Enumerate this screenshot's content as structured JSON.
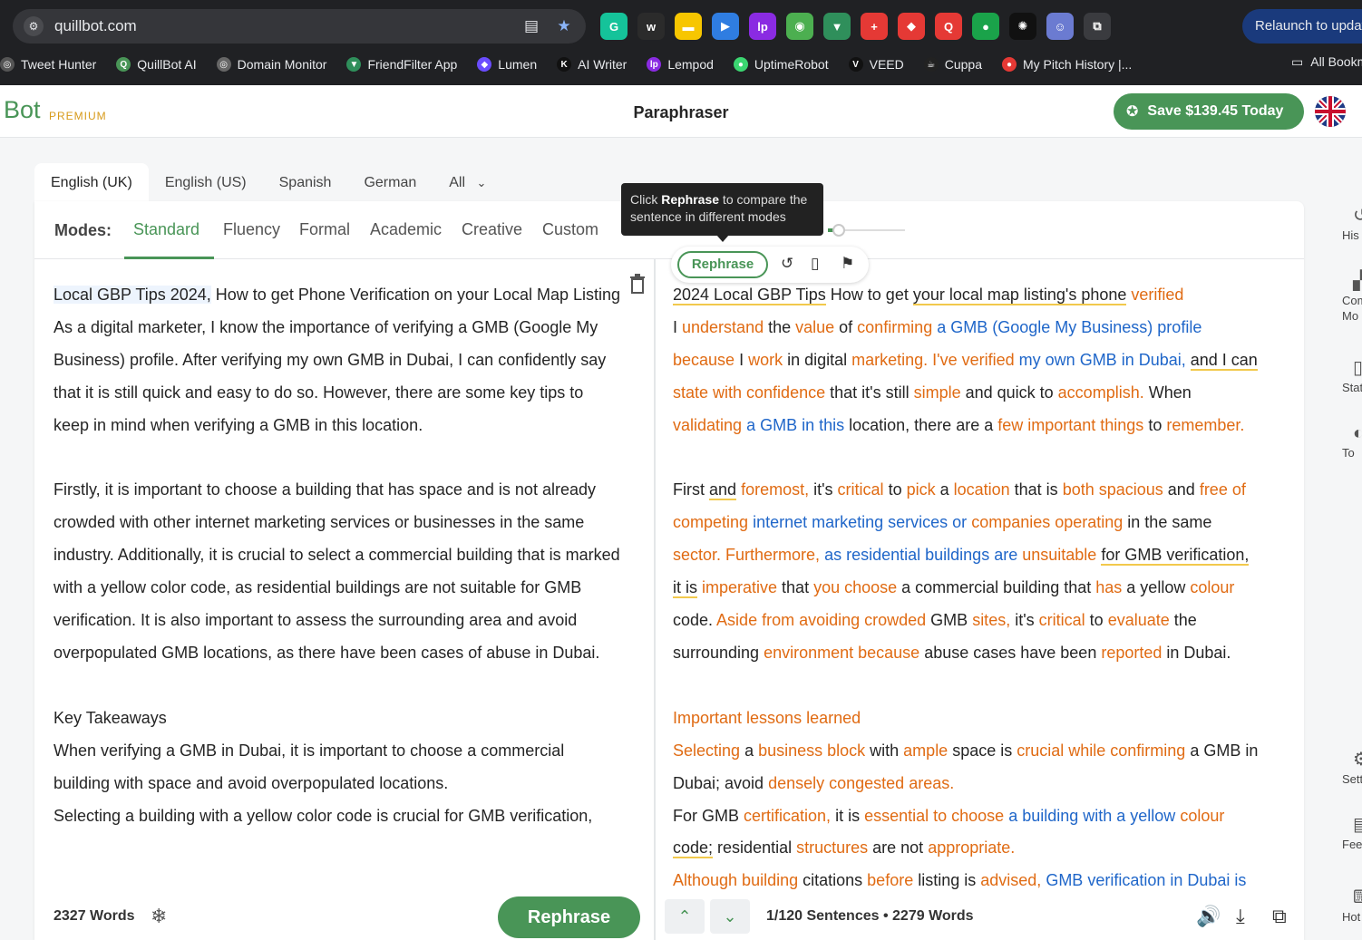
{
  "browser": {
    "url": "quillbot.com",
    "relaunch_label": "Relaunch to update",
    "extensions": [
      {
        "icon": "grammarly-icon",
        "glyph": "G",
        "color": "#15c39a"
      },
      {
        "icon": "wordtune-icon",
        "glyph": "w",
        "color": "#2b2b2b"
      },
      {
        "icon": "notes-icon",
        "glyph": "▬",
        "color": "#f7c600"
      },
      {
        "icon": "play-icon",
        "glyph": "▶",
        "color": "#2f7de1"
      },
      {
        "icon": "lempod-icon",
        "glyph": "lp",
        "color": "#8a2be2"
      },
      {
        "icon": "robot-icon",
        "glyph": "◉",
        "color": "#4caf50"
      },
      {
        "icon": "filter-icon",
        "glyph": "▼",
        "color": "#2f8f5b"
      },
      {
        "icon": "plus-box-icon",
        "glyph": "+",
        "color": "#e53935"
      },
      {
        "icon": "puzzle-red-icon",
        "glyph": "◆",
        "color": "#e53935"
      },
      {
        "icon": "search-red-icon",
        "glyph": "Q",
        "color": "#e53935"
      },
      {
        "icon": "record-icon",
        "glyph": "●",
        "color": "#1aa34a"
      },
      {
        "icon": "openai-icon",
        "glyph": "✺",
        "color": "#111111"
      },
      {
        "icon": "avatar-ext-icon",
        "glyph": "☺",
        "color": "#6b7bd1"
      },
      {
        "icon": "extensions-icon",
        "glyph": "⧉",
        "color": "#3a3b3f"
      }
    ],
    "bookmarks": [
      {
        "label": "Tweet Hunter",
        "icon": "tweet-hunter-icon",
        "color": "#555555",
        "glyph": "◎"
      },
      {
        "label": "QuillBot AI",
        "icon": "quillbot-icon",
        "color": "#499557",
        "glyph": "Q"
      },
      {
        "label": "Domain Monitor",
        "icon": "domain-monitor-icon",
        "color": "#666666",
        "glyph": "◎"
      },
      {
        "label": "FriendFilter App",
        "icon": "friendfilter-icon",
        "color": "#2f8f5b",
        "glyph": "▼"
      },
      {
        "label": "Lumen",
        "icon": "lumen-icon",
        "color": "#6a4cff",
        "glyph": "◆"
      },
      {
        "label": "AI Writer",
        "icon": "ai-writer-icon",
        "color": "#111111",
        "glyph": "K"
      },
      {
        "label": "Lempod",
        "icon": "lempod-bm-icon",
        "color": "#8a2be2",
        "glyph": "lp"
      },
      {
        "label": "UptimeRobot",
        "icon": "uptimerobot-icon",
        "color": "#3bd671",
        "glyph": "●"
      },
      {
        "label": "VEED",
        "icon": "veed-icon",
        "color": "#111111",
        "glyph": "V"
      },
      {
        "label": "Cuppa",
        "icon": "cuppa-icon",
        "color": "#222222",
        "glyph": "☕"
      },
      {
        "label": "My Pitch History |...",
        "icon": "pitch-history-icon",
        "color": "#e53935",
        "glyph": "●"
      }
    ],
    "all_bookmarks_label": "All Bookmarks"
  },
  "app": {
    "logo_text": "Bot",
    "premium_label": "PREMIUM",
    "page_title": "Paraphraser",
    "save_label": "Save $139.45 Today",
    "brand_color": "#499557"
  },
  "languages": [
    "English (UK)",
    "English (US)",
    "Spanish",
    "German",
    "All"
  ],
  "modes": {
    "label": "Modes:",
    "items": [
      "Standard",
      "Fluency",
      "Formal",
      "Academic",
      "Creative",
      "Custom"
    ],
    "active": "Standard"
  },
  "tooltip": {
    "pre": "Click ",
    "bold": "Rephrase",
    "post": " to compare the sentence in different modes"
  },
  "sentence_toolbar": {
    "rephrase_label": "Rephrase"
  },
  "input_text": {
    "highlight": "Local GBP Tips 2024,",
    "rest": " How to get Phone Verification on your Local Map Listing\nAs a digital marketer, I know the importance of verifying a GMB (Google My Business) profile. After verifying my own GMB in Dubai, I can confidently say that it is still quick and easy to do so. However, there are some key tips to keep in mind when verifying a GMB in this location.\n\nFirstly, it is important to choose a building that has space and is not already crowded with other internet marketing services or businesses in the same industry. Additionally, it is crucial to select a commercial building that is marked with a yellow color code, as residential buildings are not suitable for GMB verification. It is also important to assess the surrounding area and avoid overpopulated GMB locations, as there have been cases of abuse in Dubai.\n\nKey Takeaways\nWhen verifying a GMB in Dubai, it is important to choose a commercial building with space and avoid overpopulated locations.\nSelecting a building with a yellow color code is crucial for GMB verification,"
  },
  "output_segments": [
    {
      "t": "2024 Local GBP Tips",
      "c": "u"
    },
    {
      "t": " How to get ",
      "c": ""
    },
    {
      "t": "your local map listing's phone",
      "c": "u"
    },
    {
      "t": " ",
      "c": ""
    },
    {
      "t": "verified",
      "c": "o"
    },
    {
      "t": "\nI ",
      "c": ""
    },
    {
      "t": "understand",
      "c": "o"
    },
    {
      "t": " the ",
      "c": ""
    },
    {
      "t": "value",
      "c": "o"
    },
    {
      "t": " of ",
      "c": ""
    },
    {
      "t": "confirming",
      "c": "o"
    },
    {
      "t": " ",
      "c": ""
    },
    {
      "t": "a GMB (Google My Business) profile",
      "c": "b"
    },
    {
      "t": "\n",
      "c": ""
    },
    {
      "t": "because",
      "c": "o"
    },
    {
      "t": " I ",
      "c": ""
    },
    {
      "t": "work",
      "c": "o"
    },
    {
      "t": " in digital ",
      "c": ""
    },
    {
      "t": "marketing. I've verified",
      "c": "o"
    },
    {
      "t": " ",
      "c": ""
    },
    {
      "t": "my own GMB in Dubai,",
      "c": "b"
    },
    {
      "t": " ",
      "c": ""
    },
    {
      "t": "and I can",
      "c": "u"
    },
    {
      "t": "\n",
      "c": ""
    },
    {
      "t": "state with confidence",
      "c": "o"
    },
    {
      "t": " that it's still ",
      "c": ""
    },
    {
      "t": "simple",
      "c": "o"
    },
    {
      "t": " and quick to ",
      "c": ""
    },
    {
      "t": "accomplish.",
      "c": "o"
    },
    {
      "t": " When\n",
      "c": ""
    },
    {
      "t": "validating",
      "c": "o"
    },
    {
      "t": " ",
      "c": ""
    },
    {
      "t": "a GMB in this",
      "c": "b"
    },
    {
      "t": " location, there are a ",
      "c": ""
    },
    {
      "t": "few important things",
      "c": "o"
    },
    {
      "t": " to ",
      "c": ""
    },
    {
      "t": "remember.",
      "c": "o"
    },
    {
      "t": "\n\nFirst ",
      "c": ""
    },
    {
      "t": "and",
      "c": "u"
    },
    {
      "t": " ",
      "c": ""
    },
    {
      "t": "foremost,",
      "c": "o"
    },
    {
      "t": " it's ",
      "c": ""
    },
    {
      "t": "critical",
      "c": "o"
    },
    {
      "t": " to ",
      "c": ""
    },
    {
      "t": "pick",
      "c": "o"
    },
    {
      "t": " a ",
      "c": ""
    },
    {
      "t": "location",
      "c": "o"
    },
    {
      "t": " that is ",
      "c": ""
    },
    {
      "t": "both spacious",
      "c": "o"
    },
    {
      "t": " and ",
      "c": ""
    },
    {
      "t": "free of\ncompeting",
      "c": "o"
    },
    {
      "t": " ",
      "c": ""
    },
    {
      "t": "internet marketing services or",
      "c": "b"
    },
    {
      "t": " ",
      "c": ""
    },
    {
      "t": "companies operating",
      "c": "o"
    },
    {
      "t": " in the same\n",
      "c": ""
    },
    {
      "t": "sector. Furthermore,",
      "c": "o"
    },
    {
      "t": " ",
      "c": ""
    },
    {
      "t": "as residential buildings are",
      "c": "b"
    },
    {
      "t": " ",
      "c": ""
    },
    {
      "t": "unsuitable",
      "c": "o"
    },
    {
      "t": " ",
      "c": ""
    },
    {
      "t": "for GMB verification,",
      "c": "u"
    },
    {
      "t": "\n",
      "c": ""
    },
    {
      "t": "it is",
      "c": "u"
    },
    {
      "t": " ",
      "c": ""
    },
    {
      "t": "imperative",
      "c": "o"
    },
    {
      "t": " that ",
      "c": ""
    },
    {
      "t": "you choose",
      "c": "o"
    },
    {
      "t": " a commercial building that ",
      "c": ""
    },
    {
      "t": "has",
      "c": "o"
    },
    {
      "t": " a yellow ",
      "c": ""
    },
    {
      "t": "colour",
      "c": "o"
    },
    {
      "t": "\ncode. ",
      "c": ""
    },
    {
      "t": "Aside from avoiding crowded",
      "c": "o"
    },
    {
      "t": " GMB ",
      "c": ""
    },
    {
      "t": "sites,",
      "c": "o"
    },
    {
      "t": " it's ",
      "c": ""
    },
    {
      "t": "critical",
      "c": "o"
    },
    {
      "t": " to ",
      "c": ""
    },
    {
      "t": "evaluate",
      "c": "o"
    },
    {
      "t": " the\nsurrounding ",
      "c": ""
    },
    {
      "t": "environment because",
      "c": "o"
    },
    {
      "t": " abuse cases have been ",
      "c": ""
    },
    {
      "t": "reported",
      "c": "o"
    },
    {
      "t": " in Dubai.\n\n",
      "c": ""
    },
    {
      "t": "Important lessons learned",
      "c": "o"
    },
    {
      "t": "\n",
      "c": ""
    },
    {
      "t": "Selecting",
      "c": "o"
    },
    {
      "t": " a ",
      "c": ""
    },
    {
      "t": "business block",
      "c": "o"
    },
    {
      "t": " with ",
      "c": ""
    },
    {
      "t": "ample",
      "c": "o"
    },
    {
      "t": " space is ",
      "c": ""
    },
    {
      "t": "crucial while confirming",
      "c": "o"
    },
    {
      "t": " a GMB in\nDubai; avoid ",
      "c": ""
    },
    {
      "t": "densely congested areas.",
      "c": "o"
    },
    {
      "t": "\nFor GMB ",
      "c": ""
    },
    {
      "t": "certification,",
      "c": "o"
    },
    {
      "t": " it is ",
      "c": ""
    },
    {
      "t": "essential to choose",
      "c": "o"
    },
    {
      "t": " ",
      "c": ""
    },
    {
      "t": "a building with a yellow",
      "c": "b"
    },
    {
      "t": " ",
      "c": ""
    },
    {
      "t": "colour",
      "c": "o"
    },
    {
      "t": "\n",
      "c": ""
    },
    {
      "t": "code;",
      "c": "u"
    },
    {
      "t": " residential ",
      "c": ""
    },
    {
      "t": "structures",
      "c": "o"
    },
    {
      "t": " are not ",
      "c": ""
    },
    {
      "t": "appropriate.",
      "c": "o"
    },
    {
      "t": "\n",
      "c": ""
    },
    {
      "t": "Although building",
      "c": "o"
    },
    {
      "t": " citations ",
      "c": ""
    },
    {
      "t": "before",
      "c": "o"
    },
    {
      "t": " listing is ",
      "c": ""
    },
    {
      "t": "advised,",
      "c": "o"
    },
    {
      "t": " ",
      "c": ""
    },
    {
      "t": "GMB verification in Dubai is",
      "c": "b"
    }
  ],
  "input_footer": {
    "word_count": "2327 Words",
    "rephrase_label": "Rephrase"
  },
  "output_footer": {
    "sentence_info": "1/120 Sentences",
    "word_count": "2279 Words"
  },
  "rail": [
    {
      "label": "His",
      "icon": "history-icon",
      "glyph": "↺"
    },
    {
      "label": "Com Mo",
      "icon": "compare-modes-icon",
      "glyph": "▞"
    },
    {
      "label": "Stat",
      "icon": "statistics-icon",
      "glyph": "▯"
    },
    {
      "label": "To",
      "icon": "tone-icon",
      "glyph": "◐"
    },
    {
      "label": "Sett",
      "icon": "settings-icon",
      "glyph": "⚙"
    },
    {
      "label": "Feed",
      "icon": "feedback-icon",
      "glyph": "▤"
    },
    {
      "label": "Hot",
      "icon": "hotkeys-icon",
      "glyph": "⌨"
    }
  ]
}
